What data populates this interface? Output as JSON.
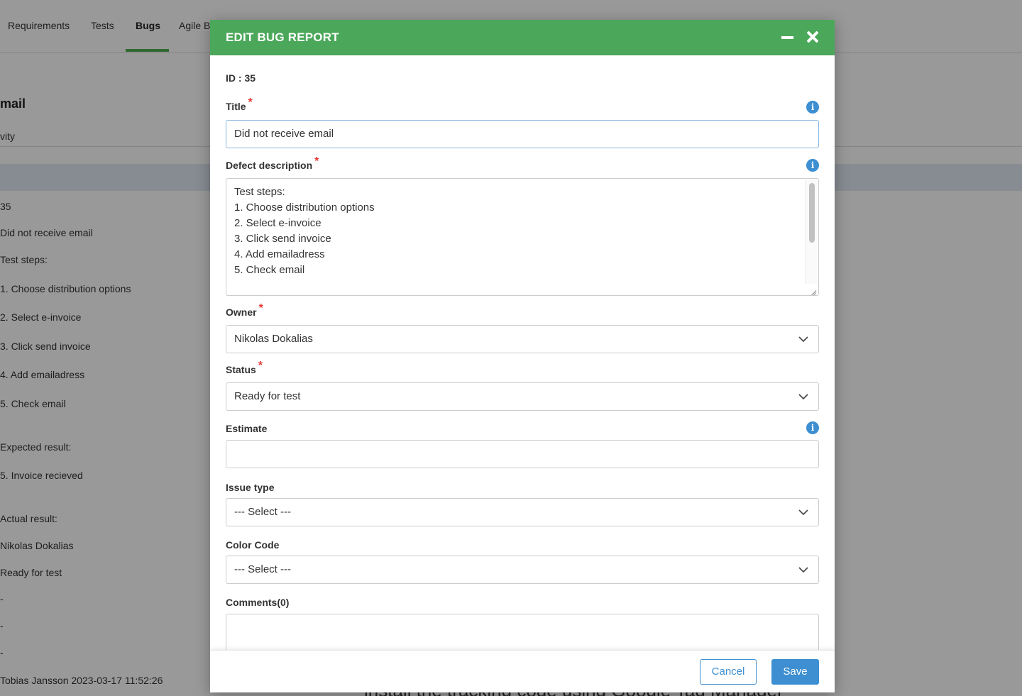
{
  "background": {
    "tabs": [
      "Requirements",
      "Tests",
      "Bugs",
      "Agile B"
    ],
    "active_tab": "Bugs",
    "heading": "mail",
    "subheading": "vity",
    "detail_lines": [
      "35",
      "Did not receive email",
      "Test steps:",
      "1. Choose distribution options",
      "2. Select e-invoice",
      "3. Click send invoice",
      "4. Add emailadress",
      "5. Check email",
      "Expected result:",
      "5. Invoice recieved",
      "Actual result:",
      "Nikolas Dokalias",
      "Ready for test",
      "-",
      "-",
      "-",
      "Tobias Jansson 2023-03-17 11:52:26"
    ],
    "footer_text": "install the tracking code using Google Tag Manager"
  },
  "modal": {
    "title": "EDIT BUG REPORT",
    "id_label": "ID : 35",
    "fields": {
      "title": {
        "label": "Title",
        "required": "*",
        "value": "Did not receive email"
      },
      "description": {
        "label": "Defect description",
        "required": "*",
        "lines": [
          "Test steps:",
          "1. Choose distribution options",
          "2. Select e-invoice",
          "3. Click send invoice",
          "4. Add emailadress",
          "5. Check email"
        ]
      },
      "owner": {
        "label": "Owner",
        "required": "*",
        "value": "Nikolas Dokalias"
      },
      "status": {
        "label": "Status",
        "required": "*",
        "value": "Ready for test"
      },
      "estimate": {
        "label": "Estimate",
        "value": ""
      },
      "issue_type": {
        "label": "Issue type",
        "value": "--- Select ---"
      },
      "color_code": {
        "label": "Color Code",
        "value": "--- Select ---"
      },
      "comments": {
        "label": "Comments(0)",
        "value": ""
      }
    },
    "footer": {
      "cancel_label": "Cancel",
      "save_label": "Save"
    }
  },
  "colors": {
    "header_green": "#4ba75a",
    "accent_blue": "#3d8fd1",
    "required_red": "#e53935"
  },
  "icons": [
    "minimize-icon",
    "close-icon",
    "info-icon",
    "chevron-down-icon",
    "resize-handle-icon"
  ]
}
